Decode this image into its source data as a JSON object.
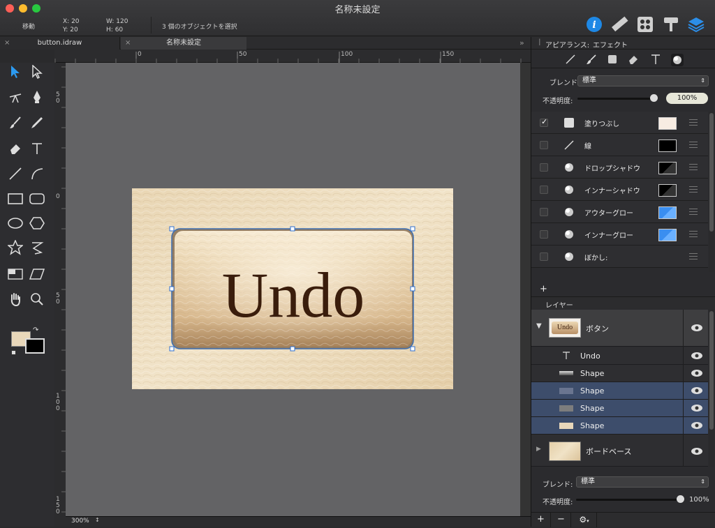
{
  "window": {
    "title": "名称未設定"
  },
  "toolbar": {
    "mode": "移動",
    "x_label": "X:",
    "x_value": "20",
    "y_label": "Y:",
    "y_value": "20",
    "w_label": "W:",
    "w_value": "120",
    "h_label": "H:",
    "h_value": "60",
    "selection_status": "3 個のオブジェクトを選択"
  },
  "tabs": [
    {
      "label": "button.idraw",
      "close": "×"
    },
    {
      "label": "名称未設定",
      "close": "×"
    }
  ],
  "tabs_overflow": "»",
  "ruler": {
    "h_ticks": [
      "0",
      "50",
      "100",
      "150"
    ],
    "v_ticks": [
      "5\n0",
      "0",
      "5\n0",
      "1\n0\n0",
      "1\n5\n0"
    ]
  },
  "canvas": {
    "button_text": "Undo",
    "zoom": "300%",
    "colors": {
      "text": "#3a1d0c",
      "selection": "#3c6fb4"
    }
  },
  "appearance": {
    "header_appearance": "アピアランス:",
    "header_effects": "エフェクト",
    "blend_label": "ブレンド",
    "blend_value": "標準",
    "opacity_label": "不透明度:",
    "opacity_value": "100%",
    "items": [
      {
        "label": "塗りつぶし",
        "checked": true,
        "swatch": "#f7ece2",
        "icon": "fill-icon"
      },
      {
        "label": "線",
        "checked": false,
        "swatch": "#000000",
        "icon": "stroke-icon"
      },
      {
        "label": "ドロップシャドウ",
        "checked": false,
        "swatch": "#000000",
        "icon": "shadow-icon"
      },
      {
        "label": "インナーシャドウ",
        "checked": false,
        "swatch": "#000000",
        "icon": "inner-shadow-icon"
      },
      {
        "label": "アウターグロー",
        "checked": false,
        "swatch": "#3a8ef0",
        "icon": "outer-glow-icon"
      },
      {
        "label": "インナーグロー",
        "checked": false,
        "swatch": "#3a8ef0",
        "icon": "inner-glow-icon"
      },
      {
        "label": "ぼかし:",
        "checked": false,
        "swatch": "",
        "icon": "blur-icon"
      }
    ],
    "add": "+"
  },
  "layers": {
    "header": "レイヤー",
    "group": {
      "name": "ボタン",
      "thumb_text": "Undo"
    },
    "children": [
      {
        "name": "Undo",
        "type": "text",
        "selected": false
      },
      {
        "name": "Shape",
        "type": "shape",
        "selected": false
      },
      {
        "name": "Shape",
        "type": "shape",
        "selected": true
      },
      {
        "name": "Shape",
        "type": "shape",
        "selected": true
      },
      {
        "name": "Shape",
        "type": "shape",
        "selected": true
      }
    ],
    "base": {
      "name": "ボードベース"
    },
    "blend_label": "ブレンド:",
    "blend_value": "標準",
    "opacity_label": "不透明度:",
    "opacity_value": "100%",
    "add": "+",
    "remove": "−"
  }
}
